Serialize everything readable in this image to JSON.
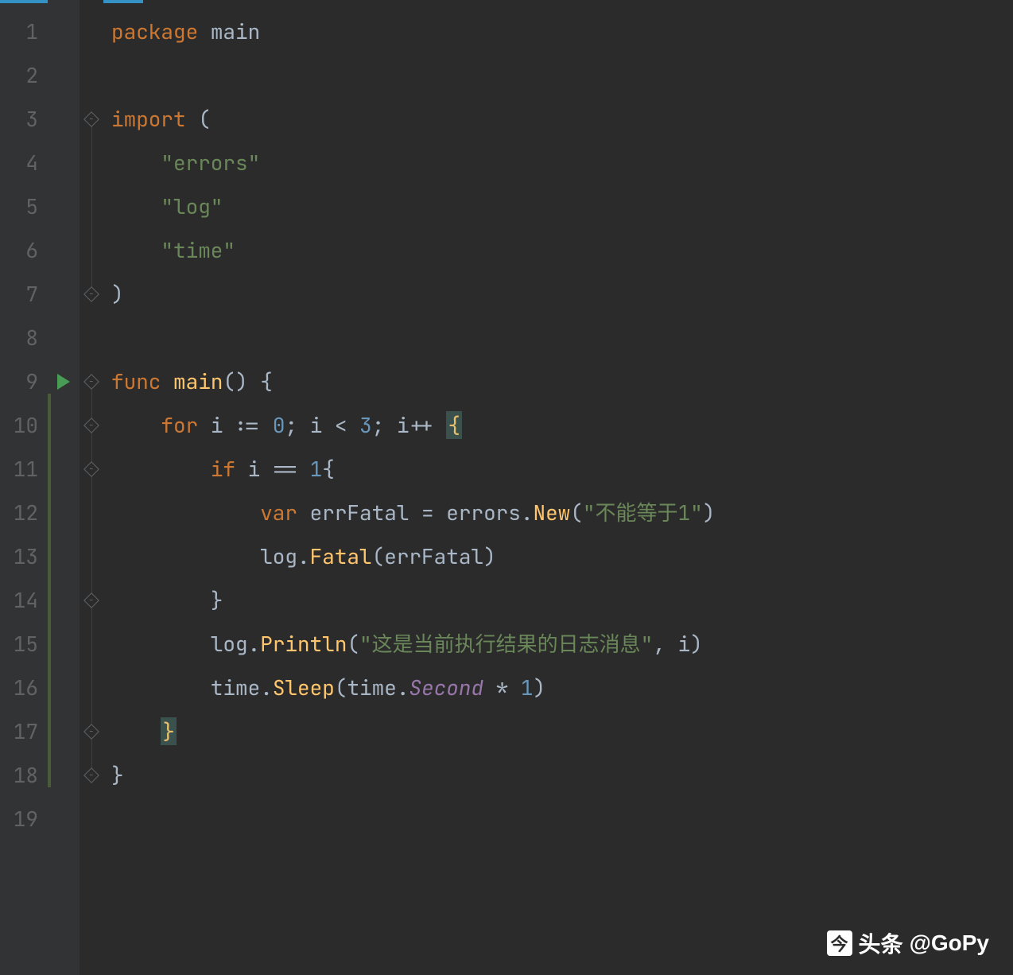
{
  "lineNumbers": [
    "1",
    "2",
    "3",
    "4",
    "5",
    "6",
    "7",
    "8",
    "9",
    "10",
    "11",
    "12",
    "13",
    "14",
    "15",
    "16",
    "17",
    "18",
    "19"
  ],
  "code": {
    "l1": {
      "kw_package": "package",
      "pkg": "main"
    },
    "l3": {
      "kw_import": "import",
      "lparen": "("
    },
    "l4": {
      "str": "\"errors\""
    },
    "l5": {
      "str": "\"log\""
    },
    "l6": {
      "str": "\"time\""
    },
    "l7": {
      "rparen": ")"
    },
    "l9": {
      "kw_func": "func",
      "name": "main",
      "parens": "()",
      "brace": "{"
    },
    "l10": {
      "kw_for": "for",
      "var_i": "i",
      "op_assign": ":=",
      "num0": "0",
      "semi1": ";",
      "var_i2": "i",
      "op_lt": "<",
      "num3": "3",
      "semi2": ";",
      "var_i3": "i",
      "op_inc": "++",
      "brace": "{"
    },
    "l11": {
      "kw_if": "if",
      "var_i": "i",
      "op_eq": "==",
      "num1": "1",
      "brace": "{"
    },
    "l12": {
      "kw_var": "var",
      "varname": "errFatal",
      "op_eq": "=",
      "pkg": "errors",
      "dot": ".",
      "call": "New",
      "lparen": "(",
      "str": "\"不能等于1\"",
      "rparen": ")"
    },
    "l13": {
      "pkg": "log",
      "dot": ".",
      "call": "Fatal",
      "lparen": "(",
      "arg": "errFatal",
      "rparen": ")"
    },
    "l14": {
      "brace": "}"
    },
    "l15": {
      "pkg": "log",
      "dot": ".",
      "call": "Println",
      "lparen": "(",
      "str": "\"这是当前执行结果的日志消息\"",
      "comma": ",",
      "arg": "i",
      "rparen": ")"
    },
    "l16": {
      "pkg": "time",
      "dot": ".",
      "call": "Sleep",
      "lparen": "(",
      "pkg2": "time",
      "dot2": ".",
      "field": "Second",
      "op": "*",
      "num": "1",
      "rparen": ")"
    },
    "l17": {
      "brace": "}"
    },
    "l18": {
      "brace": "}"
    }
  },
  "watermark": {
    "prefix": "头条",
    "handle": "@GoPy"
  },
  "runIconLine": 9,
  "foldMarkers": {
    "3": "-",
    "7": "-",
    "9": "-",
    "10": "-",
    "11": "-",
    "14": "-",
    "17": "-",
    "18": "-"
  }
}
